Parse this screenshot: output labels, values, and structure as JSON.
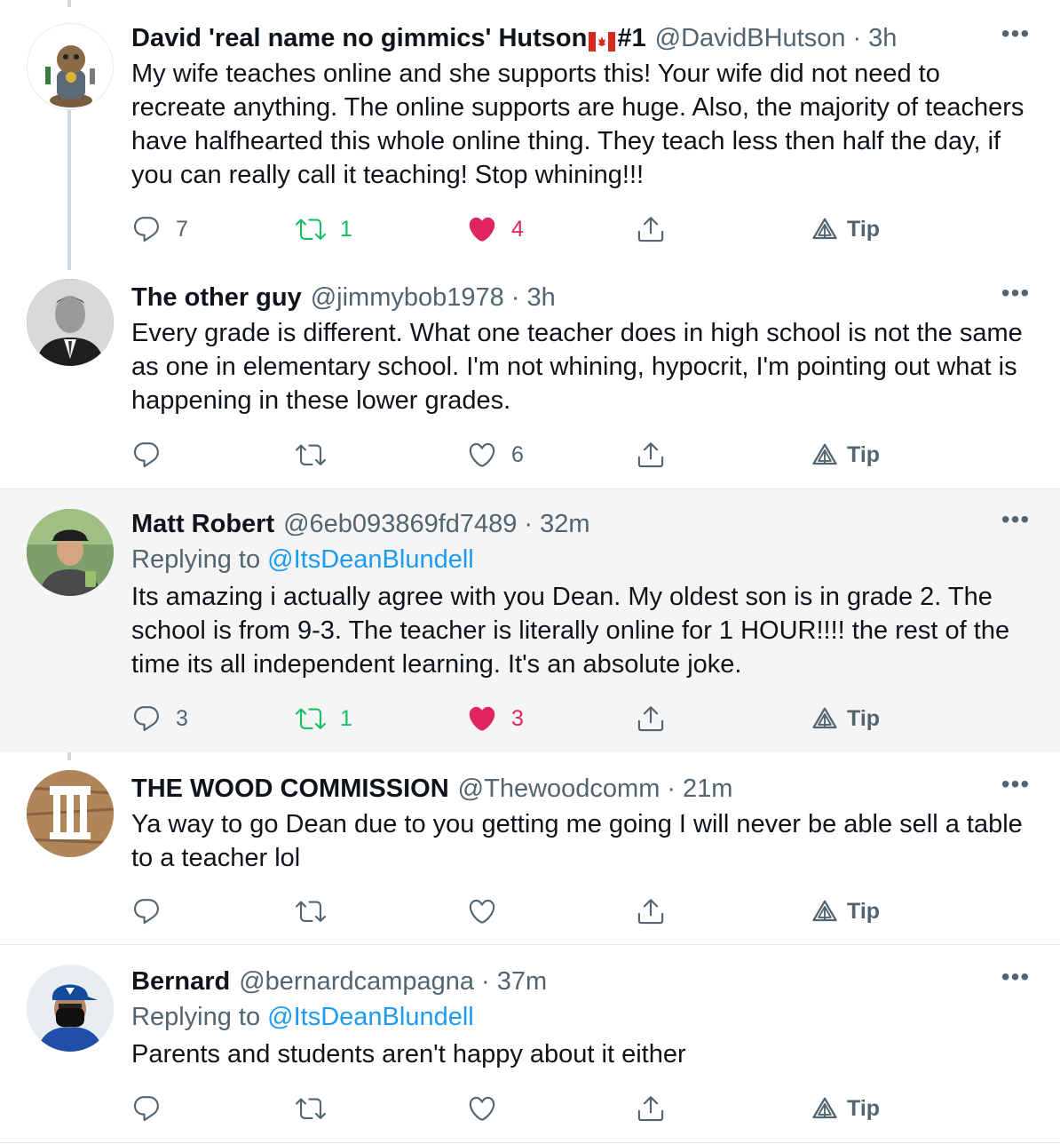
{
  "tweets": [
    {
      "name": "David 'real name no gimmics' Hutson",
      "name_suffix": "#1",
      "handle": "@DavidBHutson",
      "time": "3h",
      "replying_prefix": "",
      "replying_to": "",
      "text": "My wife teaches online and she supports this! Your wife did not need to recreate anything. The online supports are huge. Also, the majority of teachers have halfhearted this whole online thing. They teach less then half the day, if you can really call it teaching! Stop whining!!!",
      "replies": "7",
      "retweets": "1",
      "likes": "4",
      "liked": true,
      "retweeted": true,
      "tip": "Tip"
    },
    {
      "name": "The other guy",
      "handle": "@jimmybob1978",
      "time": "3h",
      "text": "Every grade is different. What one teacher does in high school is not the same as one in elementary school. I'm not whining, hypocrit, I'm pointing out what is happening in these lower grades.",
      "replies": "",
      "retweets": "",
      "likes": "6",
      "liked": false,
      "retweeted": false,
      "tip": "Tip"
    },
    {
      "name": "Matt Robert",
      "handle": "@6eb093869fd7489",
      "time": "32m",
      "replying_prefix": "Replying to",
      "replying_to": "@ItsDeanBlundell",
      "text": "Its amazing i actually agree with you Dean. My oldest son is in grade 2. The school is from 9-3. The teacher is literally online for 1 HOUR!!!! the rest of the time its all independent learning. It's an absolute joke.",
      "replies": "3",
      "retweets": "1",
      "likes": "3",
      "liked": true,
      "retweeted": true,
      "tip": "Tip"
    },
    {
      "name": "THE WOOD COMMISSION",
      "handle": "@Thewoodcomm",
      "time": "21m",
      "text": "Ya way to go Dean due to you getting me going I will never be able sell a table to a teacher lol",
      "replies": "",
      "retweets": "",
      "likes": "",
      "liked": false,
      "retweeted": false,
      "tip": "Tip"
    },
    {
      "name": "Bernard",
      "handle": "@bernardcampagna",
      "time": "37m",
      "replying_prefix": "Replying to",
      "replying_to": "@ItsDeanBlundell",
      "text": "Parents and students aren't happy about it either",
      "replies": "",
      "retweets": "",
      "likes": "",
      "liked": false,
      "retweeted": false,
      "tip": "Tip"
    }
  ],
  "separator": "·",
  "more_glyph": "•••",
  "icons": {
    "reply": "reply-icon",
    "retweet": "retweet-icon",
    "like": "heart-icon",
    "share": "share-icon",
    "tip": "tip-icon",
    "more": "more-icon"
  },
  "colors": {
    "retweet_active": "#17bf63",
    "like_active": "#e0245e",
    "link": "#1d9bf0",
    "secondary_text": "#536471",
    "highlight_bg": "#f5f5f5"
  }
}
